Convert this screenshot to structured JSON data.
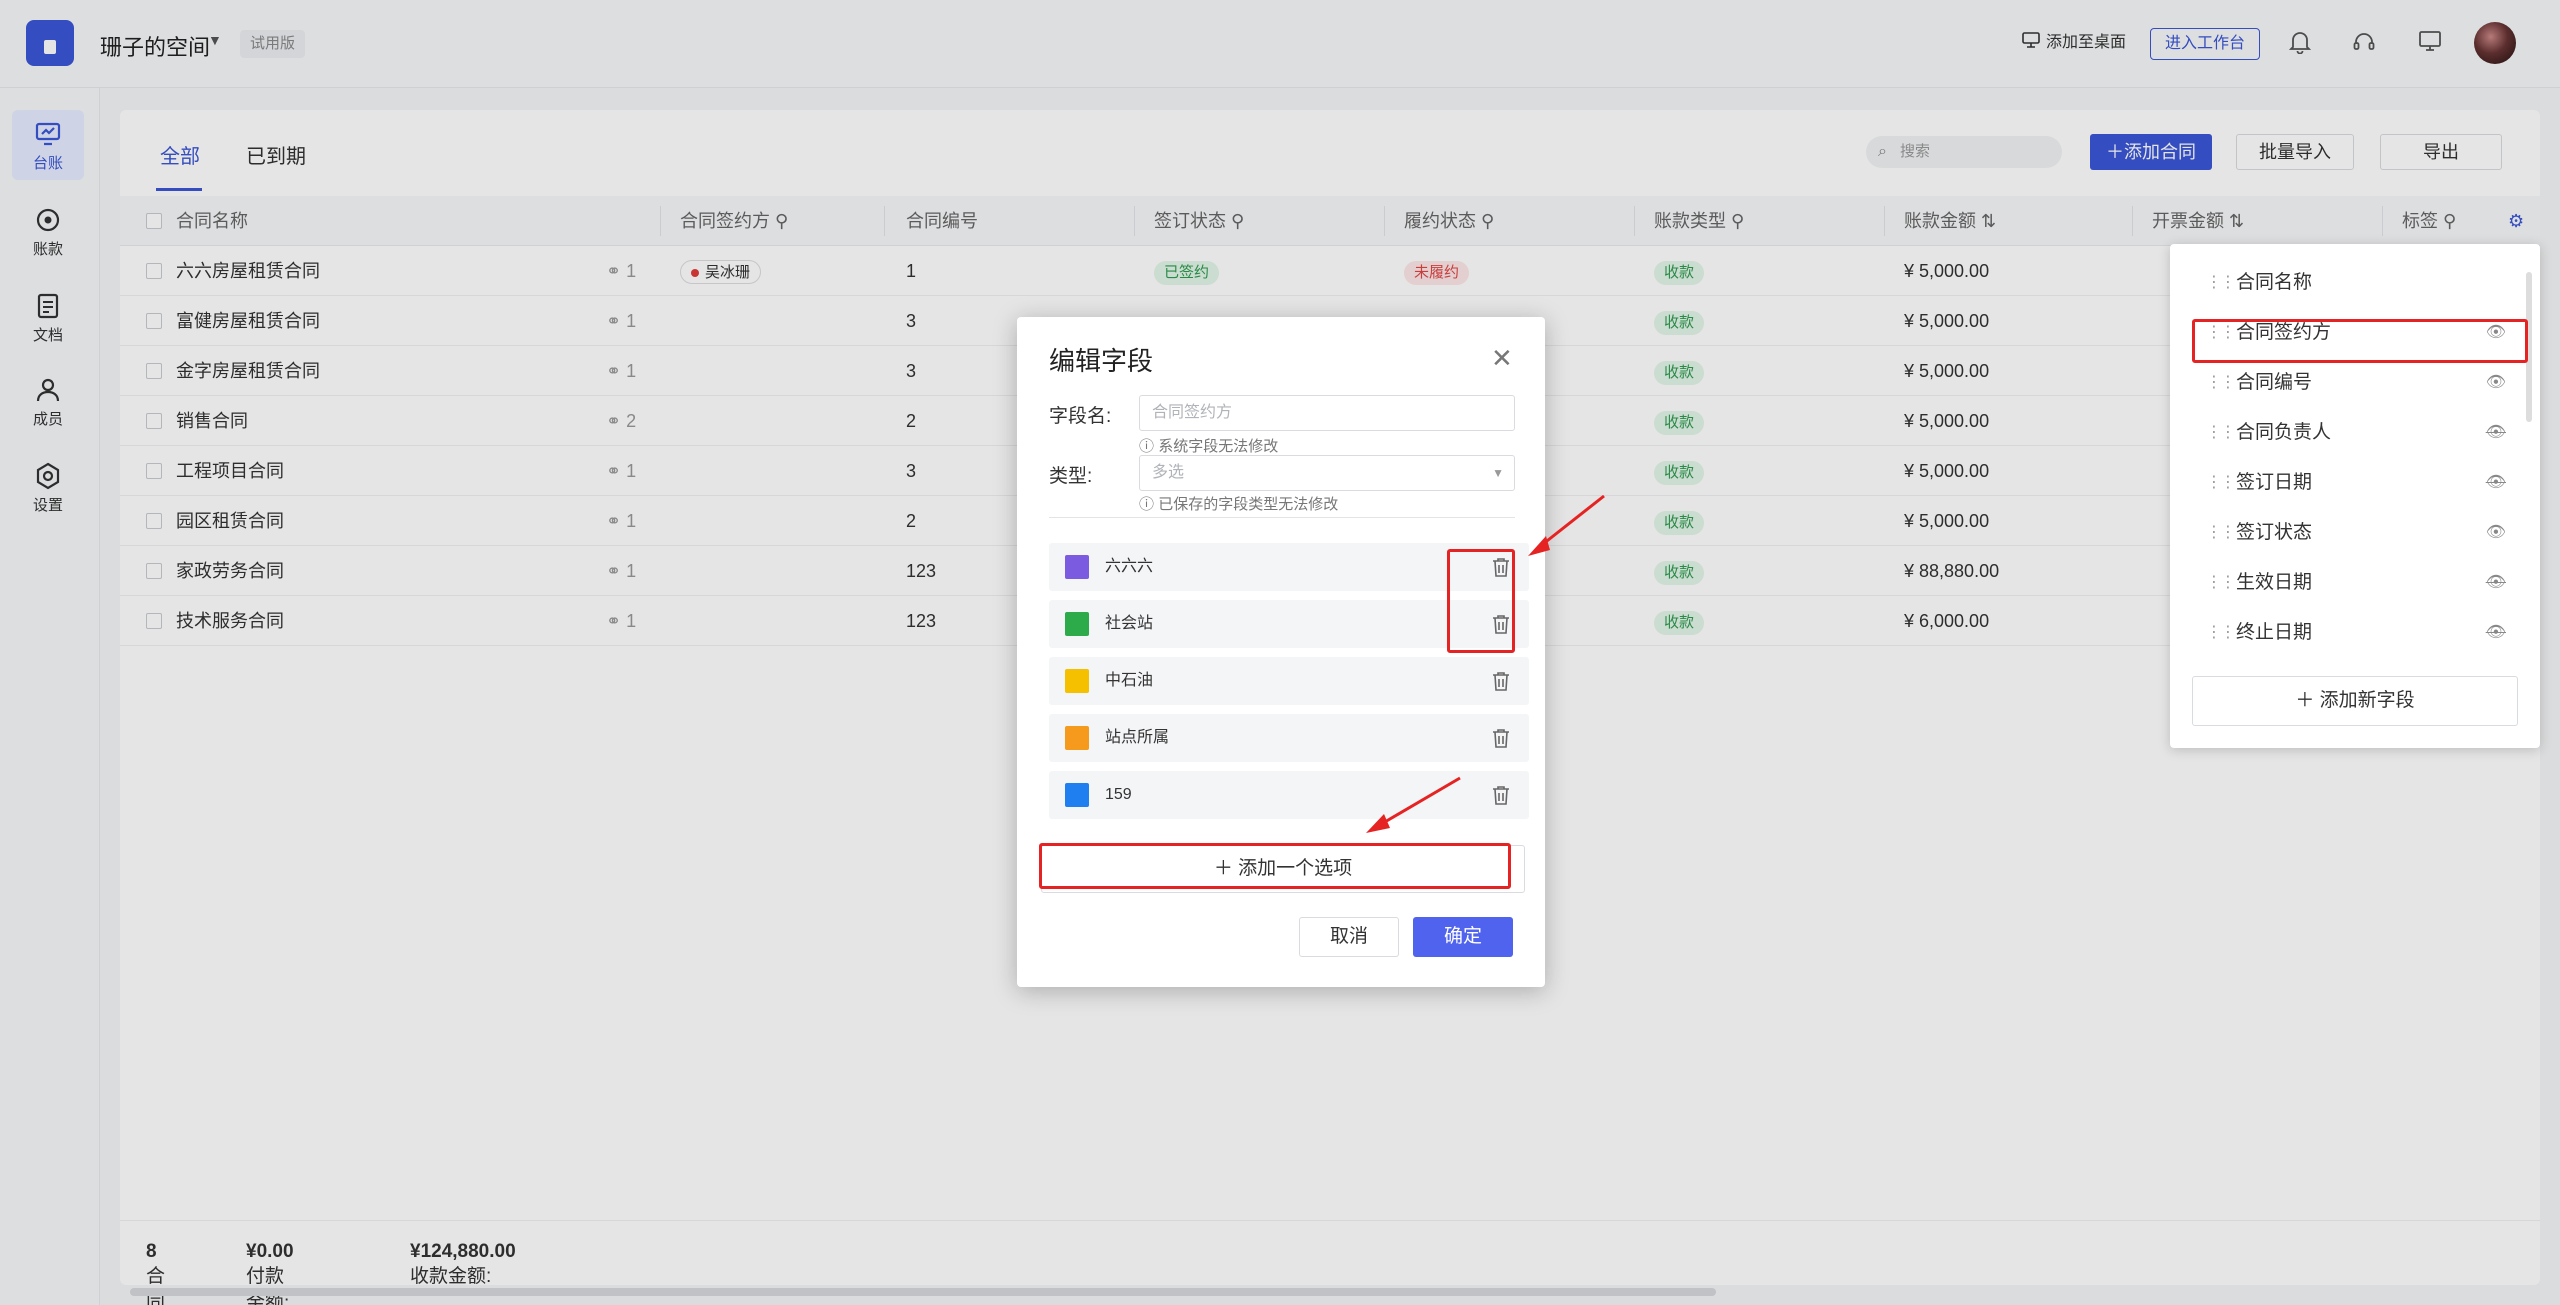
{
  "header": {
    "space_name": "珊子的空间",
    "trial_badge": "试用版",
    "add_desktop_label": "添加至桌面",
    "enter_workspace_label": "进入工作台"
  },
  "nav": {
    "items": [
      {
        "label": "台账",
        "icon": "monitor-icon",
        "active": true
      },
      {
        "label": "账款",
        "icon": "coin-icon",
        "active": false
      },
      {
        "label": "文档",
        "icon": "document-icon",
        "active": false
      },
      {
        "label": "成员",
        "icon": "user-icon",
        "active": false
      },
      {
        "label": "设置",
        "icon": "settings-icon",
        "active": false
      }
    ]
  },
  "tabs": [
    {
      "label": "全部",
      "active": true
    },
    {
      "label": "已到期",
      "active": false
    }
  ],
  "toolbar": {
    "search_placeholder": "搜索",
    "add_contract_label": "添加合同",
    "batch_import_label": "批量导入",
    "export_label": "导出"
  },
  "table": {
    "columns": [
      "合同名称",
      "合同签约方",
      "合同编号",
      "签订状态",
      "履约状态",
      "账款类型",
      "账款金额",
      "开票金额",
      "标签"
    ],
    "rows": [
      {
        "name": "六六房屋租赁合同",
        "attachments": "1",
        "party": "吴冰珊",
        "number": "1",
        "sign_status": "已签约",
        "perform_status": "未履约",
        "type": "收款",
        "amount": "¥ 5,000.00"
      },
      {
        "name": "富健房屋租赁合同",
        "attachments": "1",
        "party": "",
        "number": "3",
        "sign_status": "",
        "perform_status": "",
        "type": "收款",
        "amount": "¥ 5,000.00"
      },
      {
        "name": "金字房屋租赁合同",
        "attachments": "1",
        "party": "",
        "number": "3",
        "sign_status": "",
        "perform_status": "",
        "type": "收款",
        "amount": "¥ 5,000.00"
      },
      {
        "name": "销售合同",
        "attachments": "2",
        "party": "",
        "number": "2",
        "sign_status": "",
        "perform_status": "",
        "type": "收款",
        "amount": "¥ 5,000.00"
      },
      {
        "name": "工程项目合同",
        "attachments": "1",
        "party": "",
        "number": "3",
        "sign_status": "",
        "perform_status": "",
        "type": "收款",
        "amount": "¥ 5,000.00"
      },
      {
        "name": "园区租赁合同",
        "attachments": "1",
        "party": "",
        "number": "2",
        "sign_status": "",
        "perform_status": "",
        "type": "收款",
        "amount": "¥ 5,000.00"
      },
      {
        "name": "家政劳务合同",
        "attachments": "1",
        "party": "",
        "number": "123",
        "sign_status": "",
        "perform_status": "",
        "type": "收款",
        "amount": "¥ 88,880.00"
      },
      {
        "name": "技术服务合同",
        "attachments": "1",
        "party": "",
        "number": "123",
        "sign_status": "",
        "perform_status": "",
        "type": "收款",
        "amount": "¥ 6,000.00"
      }
    ]
  },
  "footer": {
    "count_label": "合同数:",
    "count_value": "8",
    "pay_label": "付款金额:",
    "pay_value": "¥0.00",
    "receive_label": "收款金额:",
    "receive_value": "¥124,880.00"
  },
  "field_panel": {
    "items": [
      {
        "label": "合同名称",
        "visible": null
      },
      {
        "label": "合同签约方",
        "visible": true
      },
      {
        "label": "合同编号",
        "visible": true
      },
      {
        "label": "合同负责人",
        "visible": false
      },
      {
        "label": "签订日期",
        "visible": false
      },
      {
        "label": "签订状态",
        "visible": true
      },
      {
        "label": "生效日期",
        "visible": false
      },
      {
        "label": "终止日期",
        "visible": false
      }
    ],
    "add_field_label": "添加新字段"
  },
  "modal": {
    "title": "编辑字段",
    "field_name_label": "字段名:",
    "field_name_value": "合同签约方",
    "field_name_hint": "系统字段无法修改",
    "type_label": "类型:",
    "type_value": "多选",
    "type_hint": "已保存的字段类型无法修改",
    "options": [
      {
        "name": "六六六",
        "color": "#7b5be0"
      },
      {
        "name": "社会站",
        "color": "#2daa4a"
      },
      {
        "name": "中石油",
        "color": "#f5c000"
      },
      {
        "name": "站点所属",
        "color": "#f59a1c"
      },
      {
        "name": "159",
        "color": "#1f7ff0"
      }
    ],
    "add_option_label": "添加一个选项",
    "cancel_label": "取消",
    "ok_label": "确定"
  },
  "colors": {
    "accent": "#3a56d6",
    "annotation_red": "#e62323"
  }
}
